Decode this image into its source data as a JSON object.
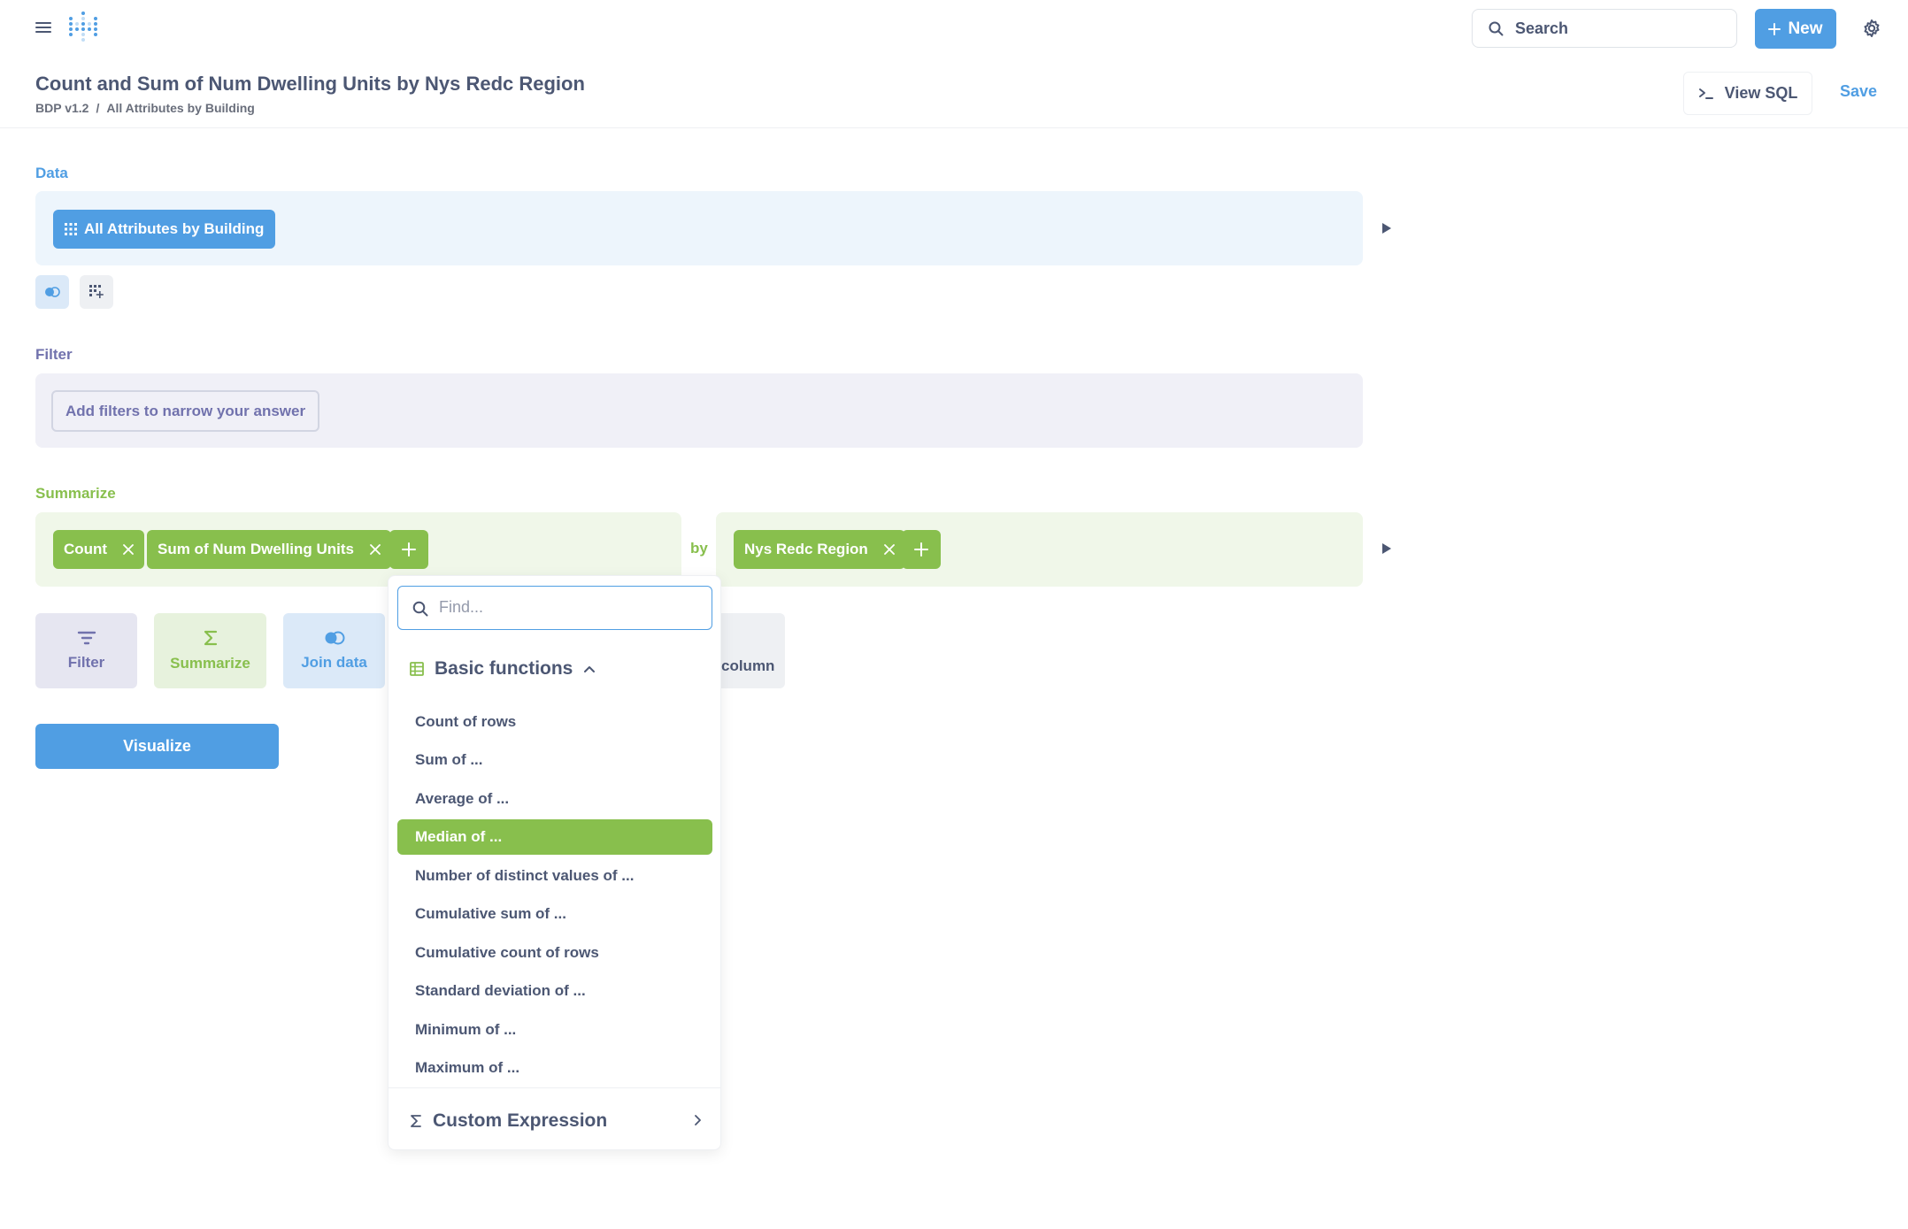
{
  "nav": {
    "search_placeholder": "Search",
    "new_label": "New"
  },
  "header": {
    "title": "Count and Sum of Num Dwelling Units by Nys Redc Region",
    "breadcrumb": [
      "BDP v1.2",
      "/",
      "All Attributes by Building"
    ],
    "view_sql_label": "View SQL",
    "save_label": "Save"
  },
  "data_section": {
    "label": "Data",
    "table": "All Attributes by Building"
  },
  "filter_section": {
    "label": "Filter",
    "add_label": "Add filters to narrow your answer"
  },
  "summarize_section": {
    "label": "Summarize",
    "metrics": [
      "Count",
      "Sum of Num Dwelling Units"
    ],
    "by_label": "by",
    "breakouts": [
      "Nys Redc Region"
    ]
  },
  "actions": {
    "filter": "Filter",
    "summarize": "Summarize",
    "join": "Join data",
    "custom_column_partial": "column"
  },
  "visualize_label": "Visualize",
  "popover": {
    "find_placeholder": "Find...",
    "group_label": "Basic functions",
    "items": [
      "Count of rows",
      "Sum of ...",
      "Average of ...",
      "Median of ...",
      "Number of distinct values of ...",
      "Cumulative sum of ...",
      "Cumulative count of rows",
      "Standard deviation of ...",
      "Minimum of ...",
      "Maximum of ..."
    ],
    "active_index": 3,
    "custom_expression_label": "Custom Expression"
  },
  "colors": {
    "brand": "#509ee3",
    "filter": "#7172ad",
    "summarize": "#88bf4d",
    "text": "#4c5773"
  }
}
